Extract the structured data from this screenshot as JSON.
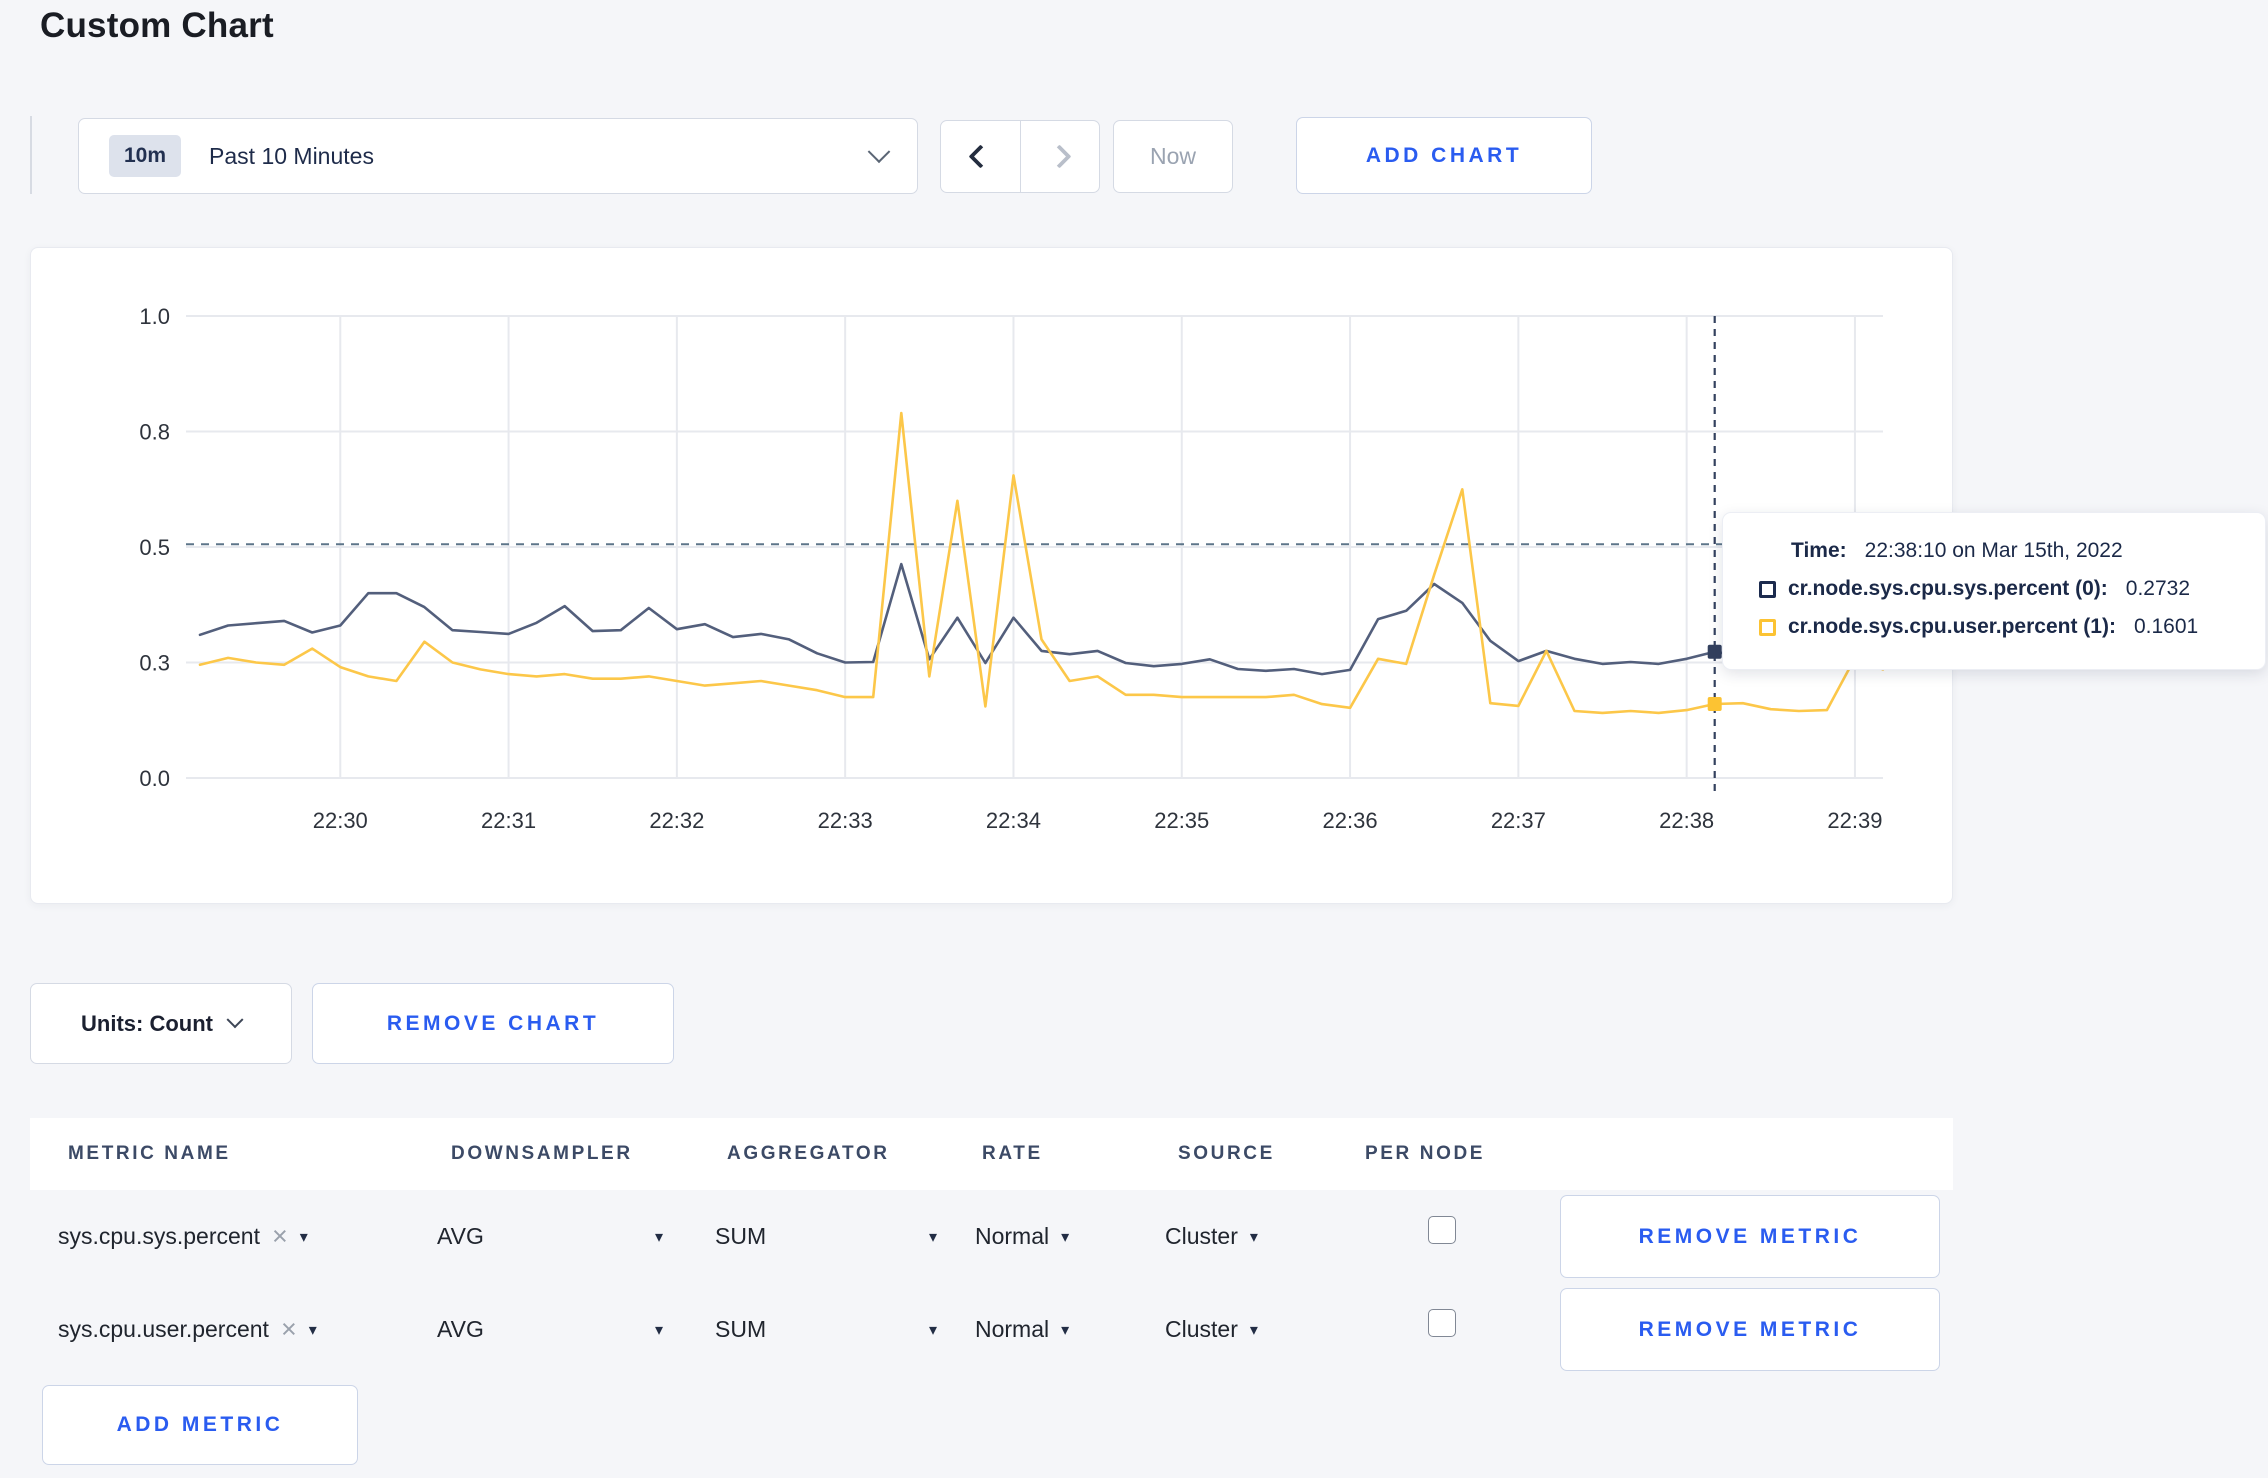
{
  "page": {
    "title": "Custom Chart"
  },
  "colors": {
    "accent_blue": "#2a5cf0",
    "series_sys": "#535f7c",
    "series_user": "#fcc749",
    "tooltip_sys_swatch": "#1c2b4e",
    "tooltip_user_swatch": "#fcc333",
    "crosshair": "#33415e",
    "threshold_line": "#5d7589"
  },
  "icons": {
    "close": "×",
    "caret_down": "▾"
  },
  "toolbar": {
    "time_range": {
      "badge": "10m",
      "label": "Past 10 Minutes"
    },
    "now_label": "Now",
    "add_chart_label": "ADD CHART"
  },
  "tooltip": {
    "time_label": "Time:",
    "time_value": "22:38:10 on Mar 15th, 2022",
    "entries": [
      {
        "label": "cr.node.sys.cpu.sys.percent (0):",
        "value": "0.2732",
        "color": "#1c2b4e"
      },
      {
        "label": "cr.node.sys.cpu.user.percent (1):",
        "value": "0.1601",
        "color": "#fcc333"
      }
    ]
  },
  "chart_footer": {
    "units_label": "Units: Count",
    "remove_chart_label": "REMOVE CHART"
  },
  "metrics_table": {
    "headers": [
      "METRIC NAME",
      "DOWNSAMPLER",
      "AGGREGATOR",
      "RATE",
      "SOURCE",
      "PER NODE"
    ],
    "rows": [
      {
        "metric": "sys.cpu.sys.percent",
        "downsampler": "AVG",
        "aggregator": "SUM",
        "rate": "Normal",
        "source": "Cluster",
        "per_node_checked": false,
        "remove_label": "REMOVE METRIC"
      },
      {
        "metric": "sys.cpu.user.percent",
        "downsampler": "AVG",
        "aggregator": "SUM",
        "rate": "Normal",
        "source": "Cluster",
        "per_node_checked": false,
        "remove_label": "REMOVE METRIC"
      }
    ],
    "add_metric_label": "ADD METRIC"
  },
  "chart_data": {
    "type": "line",
    "title": "",
    "xlabel": "",
    "ylabel": "",
    "grid": true,
    "legend_position": "tooltip-only",
    "y_axis": {
      "range": [
        0,
        1
      ],
      "ticks": [
        {
          "v": 0,
          "label": "0.0"
        },
        {
          "v": 0.25,
          "label": "0.3"
        },
        {
          "v": 0.5,
          "label": "0.5"
        },
        {
          "v": 0.75,
          "label": "0.8"
        },
        {
          "v": 1,
          "label": "1.0"
        }
      ]
    },
    "x_axis": {
      "domain_seconds": 605,
      "start_offset_seconds": 5,
      "step_seconds": 10,
      "ticks": [
        {
          "s": 55,
          "label": "22:30"
        },
        {
          "s": 115,
          "label": "22:31"
        },
        {
          "s": 175,
          "label": "22:32"
        },
        {
          "s": 235,
          "label": "22:33"
        },
        {
          "s": 295,
          "label": "22:34"
        },
        {
          "s": 355,
          "label": "22:35"
        },
        {
          "s": 415,
          "label": "22:36"
        },
        {
          "s": 475,
          "label": "22:37"
        },
        {
          "s": 535,
          "label": "22:38"
        },
        {
          "s": 595,
          "label": "22:39"
        }
      ]
    },
    "threshold_value": 0.506,
    "crosshair": {
      "s": 545,
      "index": 54,
      "time": "22:38:10"
    },
    "x_times": [
      "22:29:10",
      "22:29:20",
      "22:29:30",
      "22:29:40",
      "22:29:50",
      "22:30:00",
      "22:30:10",
      "22:30:20",
      "22:30:30",
      "22:30:40",
      "22:30:50",
      "22:31:00",
      "22:31:10",
      "22:31:20",
      "22:31:30",
      "22:31:40",
      "22:31:50",
      "22:32:00",
      "22:32:10",
      "22:32:20",
      "22:32:30",
      "22:32:40",
      "22:32:50",
      "22:33:00",
      "22:33:10",
      "22:33:20",
      "22:33:30",
      "22:33:40",
      "22:33:50",
      "22:34:00",
      "22:34:10",
      "22:34:20",
      "22:34:30",
      "22:34:40",
      "22:34:50",
      "22:35:00",
      "22:35:10",
      "22:35:20",
      "22:35:30",
      "22:35:40",
      "22:35:50",
      "22:36:00",
      "22:36:10",
      "22:36:20",
      "22:36:30",
      "22:36:40",
      "22:36:50",
      "22:37:00",
      "22:37:10",
      "22:37:20",
      "22:37:30",
      "22:37:40",
      "22:37:50",
      "22:38:00",
      "22:38:10",
      "22:38:20",
      "22:38:30",
      "22:38:40",
      "22:38:50",
      "22:39:00",
      "22:39:10"
    ],
    "series": [
      {
        "name": "cr.node.sys.cpu.sys.percent (0)",
        "color": "#535f7c",
        "marker_color": "#33405e",
        "values": [
          0.31,
          0.33,
          0.335,
          0.34,
          0.315,
          0.33,
          0.4,
          0.4,
          0.37,
          0.32,
          0.316,
          0.312,
          0.336,
          0.372,
          0.318,
          0.32,
          0.368,
          0.322,
          0.333,
          0.305,
          0.312,
          0.3,
          0.27,
          0.25,
          0.251,
          0.463,
          0.257,
          0.347,
          0.249,
          0.347,
          0.275,
          0.268,
          0.275,
          0.249,
          0.242,
          0.247,
          0.257,
          0.236,
          0.232,
          0.236,
          0.225,
          0.234,
          0.344,
          0.362,
          0.42,
          0.379,
          0.297,
          0.253,
          0.275,
          0.258,
          0.247,
          0.251,
          0.247,
          0.258,
          0.2732,
          0.264,
          0.258,
          0.255,
          0.26,
          0.27,
          0.3
        ]
      },
      {
        "name": "cr.node.sys.cpu.user.percent (1)",
        "color": "#fcc749",
        "marker_color": "#fcc333",
        "values": [
          0.245,
          0.26,
          0.25,
          0.245,
          0.28,
          0.24,
          0.22,
          0.21,
          0.295,
          0.25,
          0.235,
          0.225,
          0.22,
          0.225,
          0.215,
          0.215,
          0.22,
          0.21,
          0.2,
          0.205,
          0.21,
          0.2,
          0.19,
          0.175,
          0.175,
          0.79,
          0.22,
          0.6,
          0.155,
          0.655,
          0.3,
          0.21,
          0.22,
          0.18,
          0.18,
          0.175,
          0.175,
          0.175,
          0.175,
          0.18,
          0.16,
          0.152,
          0.258,
          0.247,
          0.44,
          0.625,
          0.162,
          0.156,
          0.275,
          0.145,
          0.141,
          0.145,
          0.141,
          0.147,
          0.1601,
          0.162,
          0.149,
          0.145,
          0.147,
          0.26,
          0.235
        ]
      }
    ]
  }
}
